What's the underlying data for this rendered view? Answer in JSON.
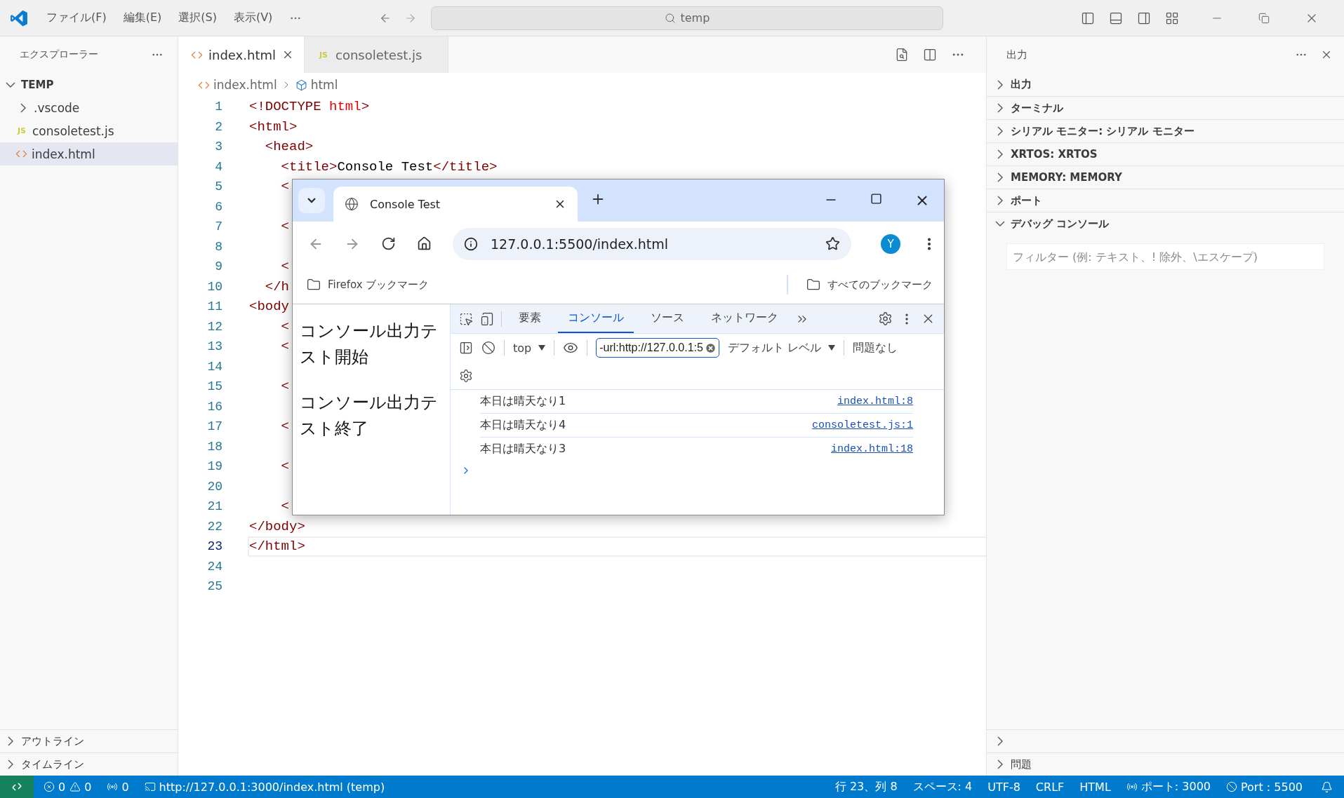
{
  "title_bar": {
    "menus": [
      "ファイル(F)",
      "編集(E)",
      "選択(S)",
      "表示(V)"
    ],
    "search": "temp"
  },
  "sidebar": {
    "title": "エクスプローラー",
    "root": {
      "title": "TEMP",
      "expanded": true
    },
    "items": [
      {
        "name": ".vscode",
        "kind": "folder",
        "expanded": false,
        "selected": false
      },
      {
        "name": "consoletest.js",
        "kind": "js",
        "badge": "JS",
        "selected": false
      },
      {
        "name": "index.html",
        "kind": "html",
        "selected": true
      }
    ],
    "sections": [
      {
        "title": "アウトライン",
        "expanded": false
      },
      {
        "title": "タイムライン",
        "expanded": false
      }
    ]
  },
  "editor": {
    "tabs": [
      {
        "label": "index.html",
        "kind": "html",
        "selected": true
      },
      {
        "label": "consoletest.js",
        "kind": "js",
        "badge": "JS",
        "selected": false
      }
    ],
    "breadcrumb": [
      {
        "label": "index.html",
        "kind": "html"
      },
      {
        "label": "html",
        "kind": "element"
      }
    ],
    "lines": [
      {
        "number": "1",
        "current": false,
        "tokens": [
          {
            "kind": "tag",
            "text": "<!DOCTYPE "
          },
          {
            "kind": "keyword",
            "text": "html"
          },
          {
            "kind": "tag",
            "text": ">"
          }
        ]
      },
      {
        "number": "2",
        "current": false,
        "tokens": [
          {
            "kind": "tag",
            "text": "<html>"
          }
        ]
      },
      {
        "number": "3",
        "current": false,
        "tokens": [
          {
            "kind": "tag",
            "text": "  <head>"
          }
        ]
      },
      {
        "number": "4",
        "current": false,
        "tokens": [
          {
            "kind": "tag",
            "text": "    <title>"
          },
          {
            "kind": "text",
            "text": "Console Test"
          },
          {
            "kind": "tag",
            "text": "</title>"
          }
        ]
      },
      {
        "number": "5",
        "current": false,
        "tokens": [
          {
            "kind": "tag",
            "text": "    <"
          }
        ]
      },
      {
        "number": "6",
        "current": false
      },
      {
        "number": "7",
        "current": false,
        "tokens": [
          {
            "kind": "tag",
            "text": "    <"
          }
        ]
      },
      {
        "number": "8",
        "current": false
      },
      {
        "number": "9",
        "current": false,
        "tokens": [
          {
            "kind": "tag",
            "text": "    <"
          }
        ]
      },
      {
        "number": "10",
        "current": false,
        "tokens": [
          {
            "kind": "tag",
            "text": "  </h"
          }
        ]
      },
      {
        "number": "11",
        "current": false,
        "tokens": [
          {
            "kind": "tag",
            "text": "<body"
          }
        ]
      },
      {
        "number": "12",
        "current": false,
        "tokens": [
          {
            "kind": "tag",
            "text": "    <"
          }
        ]
      },
      {
        "number": "13",
        "current": false,
        "tokens": [
          {
            "kind": "tag",
            "text": "    <"
          }
        ]
      },
      {
        "number": "14",
        "current": false
      },
      {
        "number": "15",
        "current": false,
        "tokens": [
          {
            "kind": "tag",
            "text": "    <"
          }
        ]
      },
      {
        "number": "16",
        "current": false
      },
      {
        "number": "17",
        "current": false,
        "tokens": [
          {
            "kind": "tag",
            "text": "    <"
          }
        ]
      },
      {
        "number": "18",
        "current": false
      },
      {
        "number": "19",
        "current": false,
        "tokens": [
          {
            "kind": "tag",
            "text": "    <"
          }
        ]
      },
      {
        "number": "20",
        "current": false
      },
      {
        "number": "21",
        "current": false,
        "tokens": [
          {
            "kind": "tag",
            "text": "    <"
          }
        ]
      },
      {
        "number": "22",
        "current": false,
        "tokens": [
          {
            "kind": "tag",
            "text": "</body>"
          }
        ]
      },
      {
        "number": "23",
        "current": true,
        "tokens": [
          {
            "kind": "tag",
            "text": "</html>"
          }
        ]
      },
      {
        "number": "24",
        "current": false
      },
      {
        "number": "25",
        "current": false
      }
    ]
  },
  "browser": {
    "tab_title": "Console Test",
    "url": "127.0.0.1:5500/index.html",
    "profile": "Y",
    "bookmarks": [
      {
        "label": "Firefox ブックマーク"
      }
    ],
    "all_bookmarks": "すべてのブックマーク",
    "page": [
      "コンソール出力テスト開始",
      "コンソール出力テスト終了"
    ],
    "devtools": {
      "tabs": [
        {
          "label": "要素",
          "selected": false
        },
        {
          "label": "コンソール",
          "selected": true
        },
        {
          "label": "ソース",
          "selected": false
        },
        {
          "label": "ネットワーク",
          "selected": false
        }
      ],
      "context": "top",
      "filter": "-url:http://127.0.0.1:5",
      "level": "デフォルト レベル",
      "issues": "問題なし",
      "messages": [
        {
          "text": "本日は晴天なり1",
          "source": "index.html:8"
        },
        {
          "text": "本日は晴天なり4",
          "source": "consoletest.js:1"
        },
        {
          "text": "本日は晴天なり3",
          "source": "index.html:18"
        }
      ]
    }
  },
  "panel": {
    "title": "出力",
    "sections": [
      {
        "title": "出力",
        "expanded": false
      },
      {
        "title": "ターミナル",
        "expanded": false
      },
      {
        "title": "シリアル モニター: シリアル モニター",
        "expanded": false
      },
      {
        "title": "XRTOS: XRTOS",
        "expanded": false
      },
      {
        "title": "MEMORY: MEMORY",
        "expanded": false
      },
      {
        "title": "ポート",
        "expanded": false
      },
      {
        "title": "デバッグ コンソール",
        "expanded": true
      }
    ],
    "filter_placeholder": "フィルター (例: テキスト、! 除外、\\エスケープ)",
    "bottom_sections": [
      {
        "title": "問題",
        "expanded": false
      }
    ]
  },
  "status_bar": {
    "left": [
      {
        "kind": "error",
        "label": "0"
      },
      {
        "kind": "warning",
        "label": "0"
      },
      {
        "kind": "broadcast",
        "label": "0"
      },
      {
        "kind": "cast",
        "label": "http://127.0.0.1:3000/index.html (temp)"
      }
    ],
    "right": [
      {
        "kind": "text",
        "label": "行 23、列 8"
      },
      {
        "kind": "text",
        "label": "スペース: 4"
      },
      {
        "kind": "text",
        "label": "UTF-8"
      },
      {
        "kind": "text",
        "label": "CRLF"
      },
      {
        "kind": "text",
        "label": "HTML"
      },
      {
        "kind": "broadcast",
        "label": "ポート: 3000"
      },
      {
        "kind": "ban",
        "label": "Port : 5500"
      }
    ]
  }
}
